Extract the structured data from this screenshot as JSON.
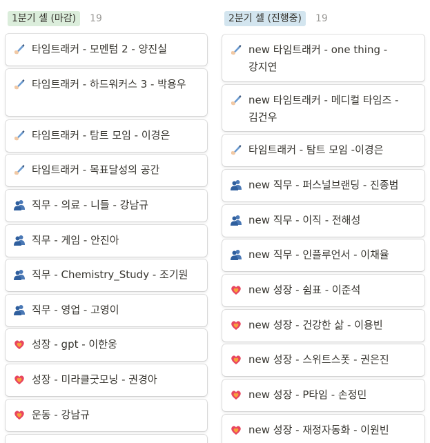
{
  "columns": [
    {
      "tag": "1분기 셀 (마감)",
      "count": "19",
      "tag_color": "#dbeddb",
      "cards": [
        {
          "icon": "writing-hand-icon",
          "title": "타임트래커 - 모멘텀 2 - 양진실"
        },
        {
          "icon": "writing-hand-icon",
          "title": "타임트래커 - 하드워커스 3 - 박용우"
        },
        {
          "icon": "writing-hand-icon",
          "title": "타임트래커 - 탐트 모임 - 이경은"
        },
        {
          "icon": "writing-hand-icon",
          "title": "타임트래커 - 목표달성의 공간"
        },
        {
          "icon": "people-icon",
          "title": "직무 - 의료 - 니들 - 강남규"
        },
        {
          "icon": "people-icon",
          "title": "직무 - 게임 - 안진아"
        },
        {
          "icon": "people-icon",
          "title": "직무 - Chemistry_Study - 조기원"
        },
        {
          "icon": "people-icon",
          "title": "직무 - 영업 - 고영이"
        },
        {
          "icon": "growing-heart-icon",
          "title": "성장 - gpt - 이한웅"
        },
        {
          "icon": "growing-heart-icon",
          "title": "성장 - 미라클굿모닝 - 권경아"
        },
        {
          "icon": "growing-heart-icon",
          "title": "운동 - 강남규"
        }
      ]
    },
    {
      "tag": "2분기 셀 (진행중)",
      "count": "19",
      "tag_color": "#d3e5ef",
      "cards": [
        {
          "icon": "writing-hand-icon",
          "title": "new 타임트래커 - one thing - 강지연"
        },
        {
          "icon": "writing-hand-icon",
          "title": "new 타임트래커 - 메디컬 타임즈 - 김건우"
        },
        {
          "icon": "writing-hand-icon",
          "title": "타임트래커 - 탐트 모임 -이경은"
        },
        {
          "icon": "people-icon",
          "title": "new 직무 - 퍼스널브랜딩 - 진종범"
        },
        {
          "icon": "people-icon",
          "title": "new 직무 - 이직 - 전해성"
        },
        {
          "icon": "people-icon",
          "title": "new 직무 - 인플루언서 - 이채율"
        },
        {
          "icon": "growing-heart-icon",
          "title": "new 성장 - 쉼표 - 이준석"
        },
        {
          "icon": "growing-heart-icon",
          "title": "new 성장 - 건강한 삶 - 이용빈"
        },
        {
          "icon": "growing-heart-icon",
          "title": "new 성장 - 스위트스폿 - 권은진"
        },
        {
          "icon": "growing-heart-icon",
          "title": "new 성장 - P타임 - 손정민"
        },
        {
          "icon": "growing-heart-icon",
          "title": "new 성장 - 재정자동화 - 이원빈"
        }
      ]
    }
  ]
}
